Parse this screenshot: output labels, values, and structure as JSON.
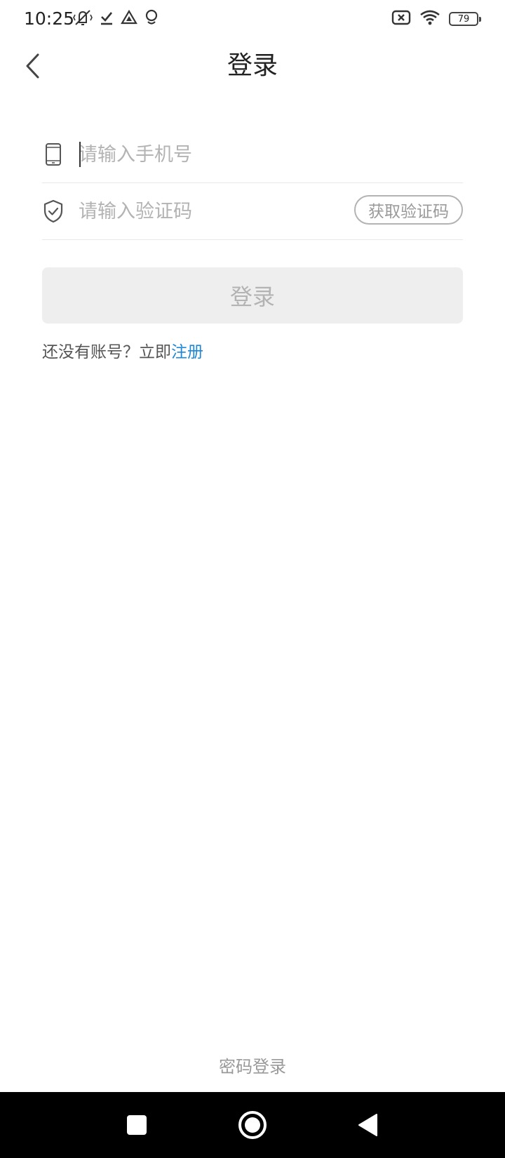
{
  "status_bar": {
    "time": "10:25",
    "battery_level": "79"
  },
  "header": {
    "title": "登录"
  },
  "form": {
    "phone_placeholder": "请输入手机号",
    "phone_value": "",
    "code_placeholder": "请输入验证码",
    "code_value": "",
    "get_code_label": "获取验证码"
  },
  "login_button_label": "登录",
  "register": {
    "prompt": "还没有账号？立即",
    "link_label": "注册"
  },
  "password_login_label": "密码登录",
  "colors": {
    "accent_link": "#1e88d6",
    "disabled_button_bg": "#eeeeee",
    "disabled_button_text": "#b3b3b3"
  }
}
